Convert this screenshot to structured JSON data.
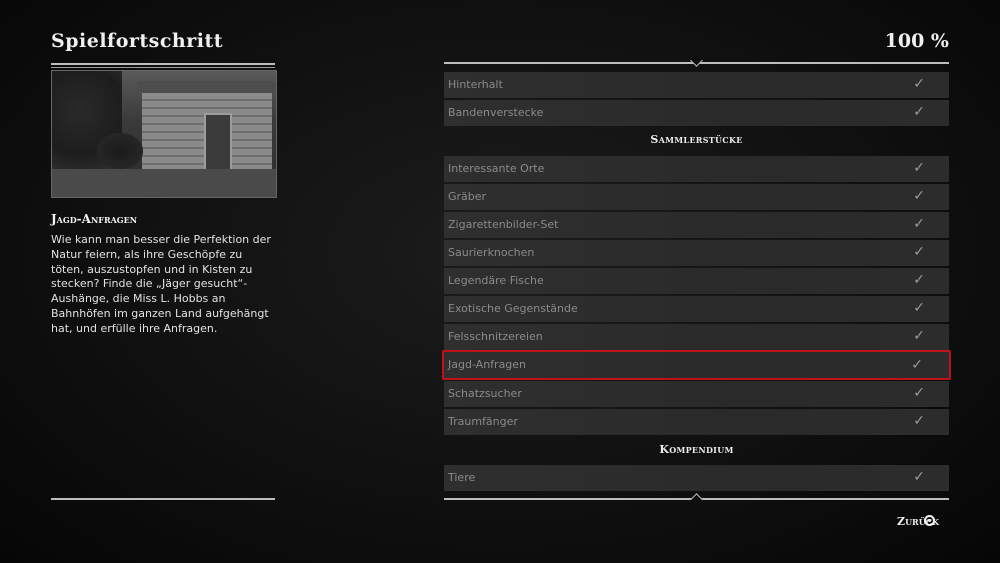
{
  "header": {
    "title": "Spielfortschritt",
    "percent": "100 %"
  },
  "detail": {
    "title": "Jagd-Anfragen",
    "body": "Wie kann man besser die Perfektion der Natur feiern, als ihre Geschöpfe zu töten, auszustopfen und in Kisten zu stecken? Finde die „Jäger gesucht“-Aushänge, die Miss L. Hobbs an Bahnhöfen im ganzen Land aufgehängt hat, und erfülle ihre Anfragen."
  },
  "list": {
    "rows_top": [
      "Hinterhalt",
      "Bandenverstecke"
    ],
    "section_collectibles": "Sammlerstücke",
    "collectibles": [
      "Interessante Orte",
      "Gräber",
      "Zigarettenbilder-Set",
      "Saurierknochen",
      "Legendäre Fische",
      "Exotische Gegenstände",
      "Felsschnitzereien",
      "Jagd-Anfragen",
      "Schatzsucher",
      "Traumfänger"
    ],
    "section_compendium": "Kompendium",
    "compendium": [
      "Tiere"
    ],
    "check_icon": "checkmark-icon",
    "selected": "Jagd-Anfragen",
    "selection_color": "#c0121b"
  },
  "footer": {
    "back_label": "Zurück",
    "back_icon": "circle-button-icon"
  }
}
